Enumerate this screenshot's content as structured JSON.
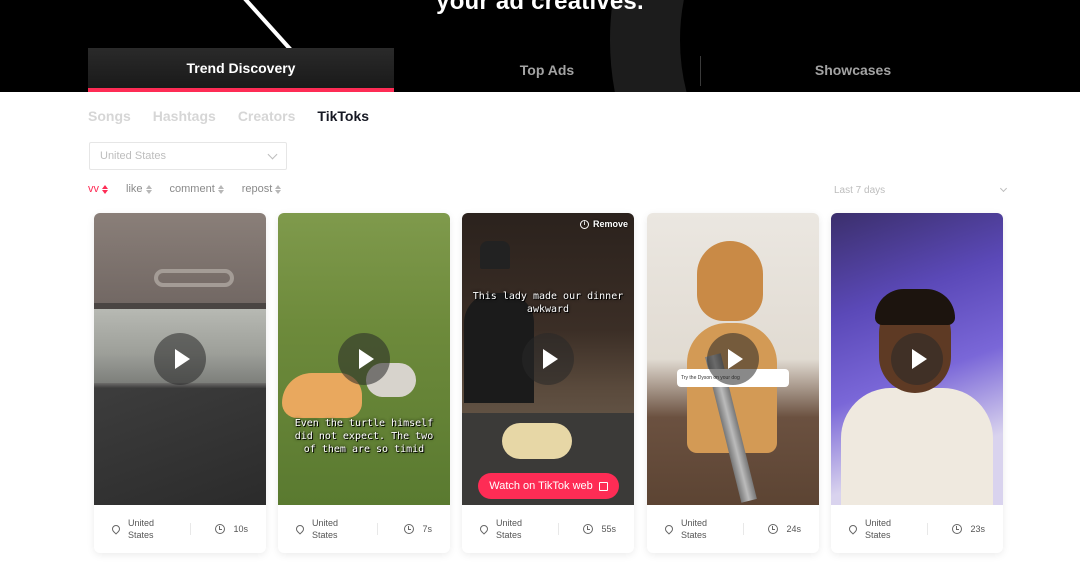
{
  "hero": {
    "title": "your ad creatives."
  },
  "tabs": [
    {
      "label": "Trend Discovery",
      "active": true
    },
    {
      "label": "Top Ads",
      "active": false
    },
    {
      "label": "Showcases",
      "active": false
    }
  ],
  "subnav": [
    "Songs",
    "Hashtags",
    "Creators",
    "TikToks"
  ],
  "filters": {
    "country": "United States",
    "period": "Last 7 days",
    "sorts": [
      "vv",
      "like",
      "comment",
      "repost"
    ]
  },
  "colors": {
    "accent": "#fe2c55",
    "header_bg": "#000000"
  },
  "cards": [
    {
      "location": "United States",
      "duration": "10s"
    },
    {
      "location": "United States",
      "duration": "7s",
      "caption": "Even the turtle himself did not expect. The two of them are so timid"
    },
    {
      "location": "United States",
      "duration": "55s",
      "caption": "This lady made our dinner awkward",
      "remove_label": "Remove",
      "watch_label": "Watch on TikTok web"
    },
    {
      "location": "United States",
      "duration": "24s",
      "comment_text": "Try the Dyson on your dog"
    },
    {
      "location": "United States",
      "duration": "23s"
    }
  ]
}
